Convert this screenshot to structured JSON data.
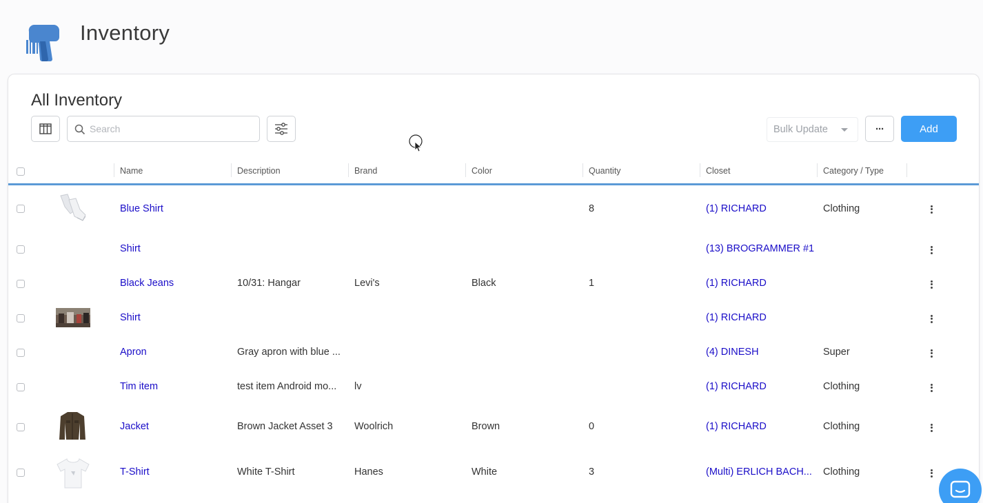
{
  "header": {
    "title": "Inventory",
    "logo_icon": "barcode-scanner-icon"
  },
  "card": {
    "title": "All Inventory",
    "search": {
      "placeholder": "Search",
      "value": ""
    },
    "bulk_update_label": "Bulk Update",
    "more_label": "···",
    "add_label": "Add"
  },
  "columns": [
    "Name",
    "Description",
    "Brand",
    "Color",
    "Quantity",
    "Closet",
    "Category / Type"
  ],
  "rows": [
    {
      "name": "Blue Shirt",
      "description": "",
      "brand": "",
      "color": "",
      "quantity": "8",
      "closet": "(1) RICHARD",
      "category": "Clothing",
      "thumb": "socks"
    },
    {
      "name": "Shirt",
      "description": "",
      "brand": "",
      "color": "",
      "quantity": "",
      "closet": "(13) BROGRAMMER #1",
      "category": "",
      "thumb": ""
    },
    {
      "name": "Black Jeans",
      "description": "10/31: Hangar",
      "brand": "Levi's",
      "color": "Black",
      "quantity": "1",
      "closet": "(1) RICHARD",
      "category": "",
      "thumb": ""
    },
    {
      "name": "Shirt",
      "description": "",
      "brand": "",
      "color": "",
      "quantity": "",
      "closet": "(1) RICHARD",
      "category": "",
      "thumb": "photo"
    },
    {
      "name": "Apron",
      "description": "Gray apron with blue ...",
      "brand": "",
      "color": "",
      "quantity": "",
      "closet": "(4) DINESH",
      "category": "Super",
      "thumb": ""
    },
    {
      "name": "Tim item",
      "description": "test item Android mo...",
      "brand": "lv",
      "color": "",
      "quantity": "",
      "closet": "(1) RICHARD",
      "category": "Clothing",
      "thumb": ""
    },
    {
      "name": "Jacket",
      "description": "Brown Jacket Asset 3",
      "brand": "Woolrich",
      "color": "Brown",
      "quantity": "0",
      "closet": "(1) RICHARD",
      "category": "Clothing",
      "thumb": "jacket"
    },
    {
      "name": "T-Shirt",
      "description": "White T-Shirt",
      "brand": "Hanes",
      "color": "White",
      "quantity": "3",
      "closet": "(Multi) ERLICH BACH...",
      "category": "Clothing",
      "thumb": "tshirt"
    }
  ],
  "colors": {
    "accent": "#3d9ef5",
    "link": "#1a0dc8",
    "header_rule": "#5b9ad6"
  }
}
